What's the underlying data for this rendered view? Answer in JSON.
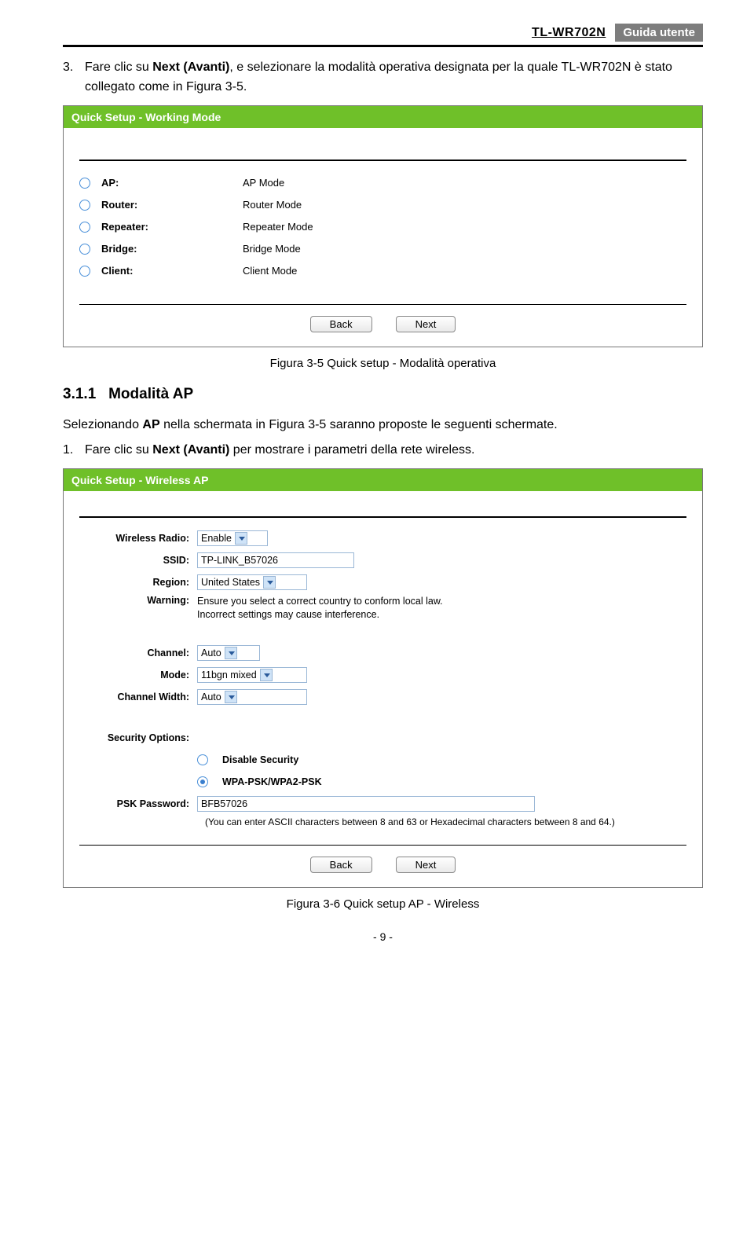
{
  "header": {
    "model": "TL-WR702N",
    "badge": "Guida utente"
  },
  "intro": {
    "num": "3.",
    "text_a": "Fare clic su ",
    "text_bold": "Next (Avanti)",
    "text_b": ", e selezionare la modalità operativa designata per la quale TL-WR702N è stato collegato come in Figura 3-5."
  },
  "shot1": {
    "title": "Quick Setup - Working Mode",
    "modes": [
      {
        "label": "AP:",
        "desc": "AP Mode"
      },
      {
        "label": "Router:",
        "desc": "Router Mode"
      },
      {
        "label": "Repeater:",
        "desc": "Repeater Mode"
      },
      {
        "label": "Bridge:",
        "desc": "Bridge Mode"
      },
      {
        "label": "Client:",
        "desc": "Client Mode"
      }
    ],
    "back": "Back",
    "next": "Next"
  },
  "caption1": "Figura 3-5 Quick setup - Modalità operativa",
  "section311": {
    "num": "3.1.1",
    "title": "Modalità AP"
  },
  "para2": {
    "a": "Selezionando ",
    "bold": "AP",
    "b": " nella schermata in Figura 3-5 saranno proposte le seguenti schermate."
  },
  "li1": {
    "num": "1.",
    "a": "Fare clic su ",
    "bold": "Next (Avanti)",
    "b": " per mostrare i parametri della rete wireless."
  },
  "shot2": {
    "title": "Quick Setup - Wireless AP",
    "labels": {
      "wireless_radio": "Wireless Radio:",
      "ssid": "SSID:",
      "region": "Region:",
      "warning": "Warning:",
      "channel": "Channel:",
      "mode": "Mode:",
      "channel_width": "Channel Width:",
      "security": "Security Options:",
      "psk": "PSK Password:"
    },
    "values": {
      "wireless_radio": "Enable",
      "ssid": "TP-LINK_B57026",
      "region": "United States",
      "warning1": "Ensure you select a correct country to conform local law.",
      "warning2": "Incorrect settings may cause interference.",
      "channel": "Auto",
      "mode": "11bgn mixed",
      "channel_width": "Auto",
      "disable_security": "Disable Security",
      "wpa": "WPA-PSK/WPA2-PSK",
      "psk": "BFB57026",
      "psk_note": "(You can enter ASCII characters between 8 and 63 or Hexadecimal characters between 8 and 64.)"
    },
    "back": "Back",
    "next": "Next"
  },
  "caption2": "Figura 3-6 Quick setup AP - Wireless",
  "page_number": "- 9 -"
}
